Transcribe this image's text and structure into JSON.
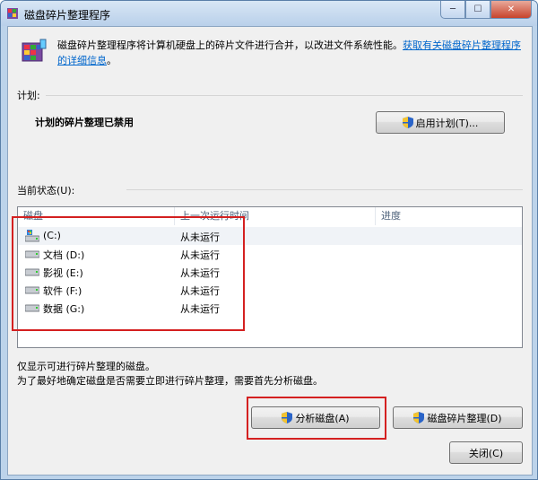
{
  "window": {
    "title": "磁盘碎片整理程序",
    "close_glyph": "✕",
    "min_glyph": "─",
    "max_glyph": "☐"
  },
  "intro": {
    "text": "磁盘碎片整理程序将计算机硬盘上的碎片文件进行合并，以改进文件系统性能。",
    "link": "获取有关磁盘碎片整理程序的详细信息",
    "link_end": "。"
  },
  "schedule": {
    "section_label": "计划:",
    "status": "计划的碎片整理已禁用",
    "enable_button": "启用计划(T)..."
  },
  "status_section": {
    "label": "当前状态(U):",
    "columns": [
      "磁盘",
      "上一次运行时间",
      "进度"
    ],
    "rows": [
      {
        "disk": "(C:)",
        "last_run": "从未运行",
        "progress": "",
        "icon": "system-drive-icon"
      },
      {
        "disk": "文档 (D:)",
        "last_run": "从未运行",
        "progress": "",
        "icon": "drive-icon"
      },
      {
        "disk": "影视 (E:)",
        "last_run": "从未运行",
        "progress": "",
        "icon": "drive-icon"
      },
      {
        "disk": "软件 (F:)",
        "last_run": "从未运行",
        "progress": "",
        "icon": "drive-icon"
      },
      {
        "disk": "数据 (G:)",
        "last_run": "从未运行",
        "progress": "",
        "icon": "drive-icon"
      }
    ]
  },
  "notes": {
    "line1": "仅显示可进行碎片整理的磁盘。",
    "line2": "为了最好地确定磁盘是否需要立即进行碎片整理，需要首先分析磁盘。"
  },
  "actions": {
    "analyze": "分析磁盘(A)",
    "defrag": "磁盘碎片整理(D)",
    "close": "关闭(C)"
  },
  "colors": {
    "highlight_red": "#d42020",
    "link_blue": "#0066cc"
  }
}
